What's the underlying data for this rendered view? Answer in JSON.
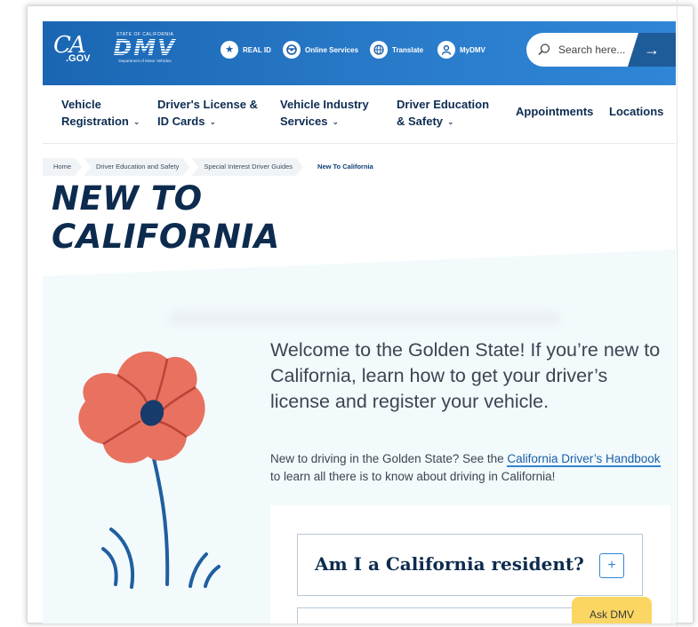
{
  "header": {
    "ca_logo": {
      "main": "CA",
      "sub": ".GOV"
    },
    "dmv_logo": {
      "state": "STATE OF CALIFORNIA",
      "word": "DMV",
      "dept": "Department of Motor Vehicles"
    },
    "utility": [
      {
        "label": "REAL ID",
        "icon": "star-icon"
      },
      {
        "label": "Online Services",
        "icon": "steering-wheel-icon"
      },
      {
        "label": "Translate",
        "icon": "globe-icon"
      },
      {
        "label": "MyDMV",
        "icon": "user-icon"
      }
    ],
    "search": {
      "placeholder": "Search here...",
      "button_glyph": "→"
    },
    "colors": {
      "header_blue": "#1a66b3",
      "accent": "#2f86d6",
      "navy": "#0d2b4e"
    }
  },
  "nav": {
    "items": [
      {
        "line1": "Vehicle",
        "line2": "Registration"
      },
      {
        "line1": "Driver's License &",
        "line2": "ID Cards"
      },
      {
        "line1": "Vehicle Industry",
        "line2": "Services"
      },
      {
        "line1": "Driver Education",
        "line2": "& Safety"
      },
      {
        "line1": "Appointments"
      },
      {
        "line1": "Locations"
      }
    ]
  },
  "breadcrumb": [
    "Home",
    "Driver Education and Safety",
    "Special Interest Driver Guides",
    "New To California"
  ],
  "page": {
    "title_line1": "NEW TO",
    "title_line2": "CALIFORNIA",
    "lead": "Welcome to the Golden State! If you’re new to California, learn how to get your driver’s license and register your vehicle.",
    "body_before": "New to driving in the Golden State? See the ",
    "body_link": "California Driver’s Handbook",
    "body_after": " to learn all there is to know about driving in California!"
  },
  "accordion": {
    "title": "Am I a California resident?",
    "toggle": "+"
  },
  "ask_dmv": "Ask DMV"
}
